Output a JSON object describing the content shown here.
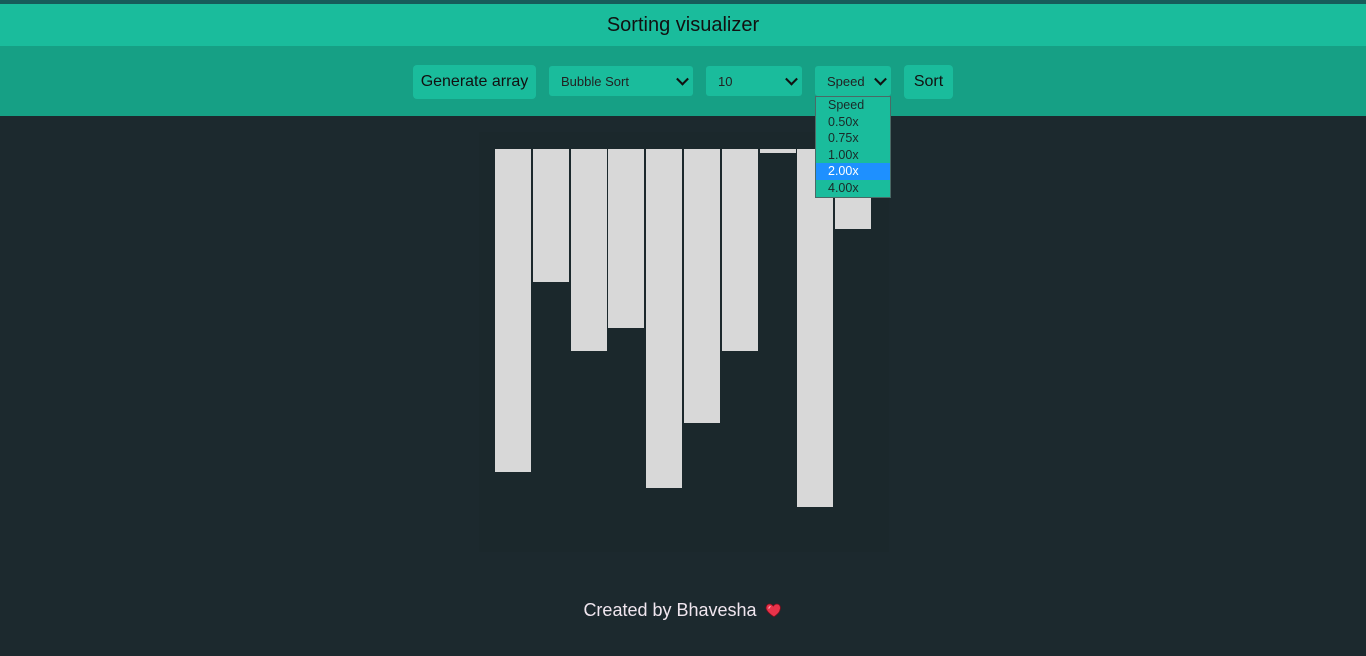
{
  "header": {
    "title": "Sorting visualizer"
  },
  "toolbar": {
    "generate_label": "Generate array",
    "algorithm_selected": "Bubble Sort",
    "size_selected": "10",
    "speed_selected": "Speed",
    "sort_label": "Sort"
  },
  "speed_dropdown": {
    "options": [
      "Speed",
      "0.50x",
      "0.75x",
      "1.00x",
      "2.00x",
      "4.00x"
    ],
    "highlighted": "2.00x"
  },
  "bars": {
    "values": [
      323,
      133,
      202,
      179,
      339,
      274,
      202,
      4,
      358,
      80
    ],
    "color": "#d8d8d8"
  },
  "footer": {
    "text": "Created by Bhavesha",
    "heart_icon": "heart-icon"
  },
  "colors": {
    "header_bg": "#1abc9c",
    "toolbar_bg": "#16a085",
    "page_bg": "#1c292e",
    "selected_option": "#1e90ff"
  }
}
